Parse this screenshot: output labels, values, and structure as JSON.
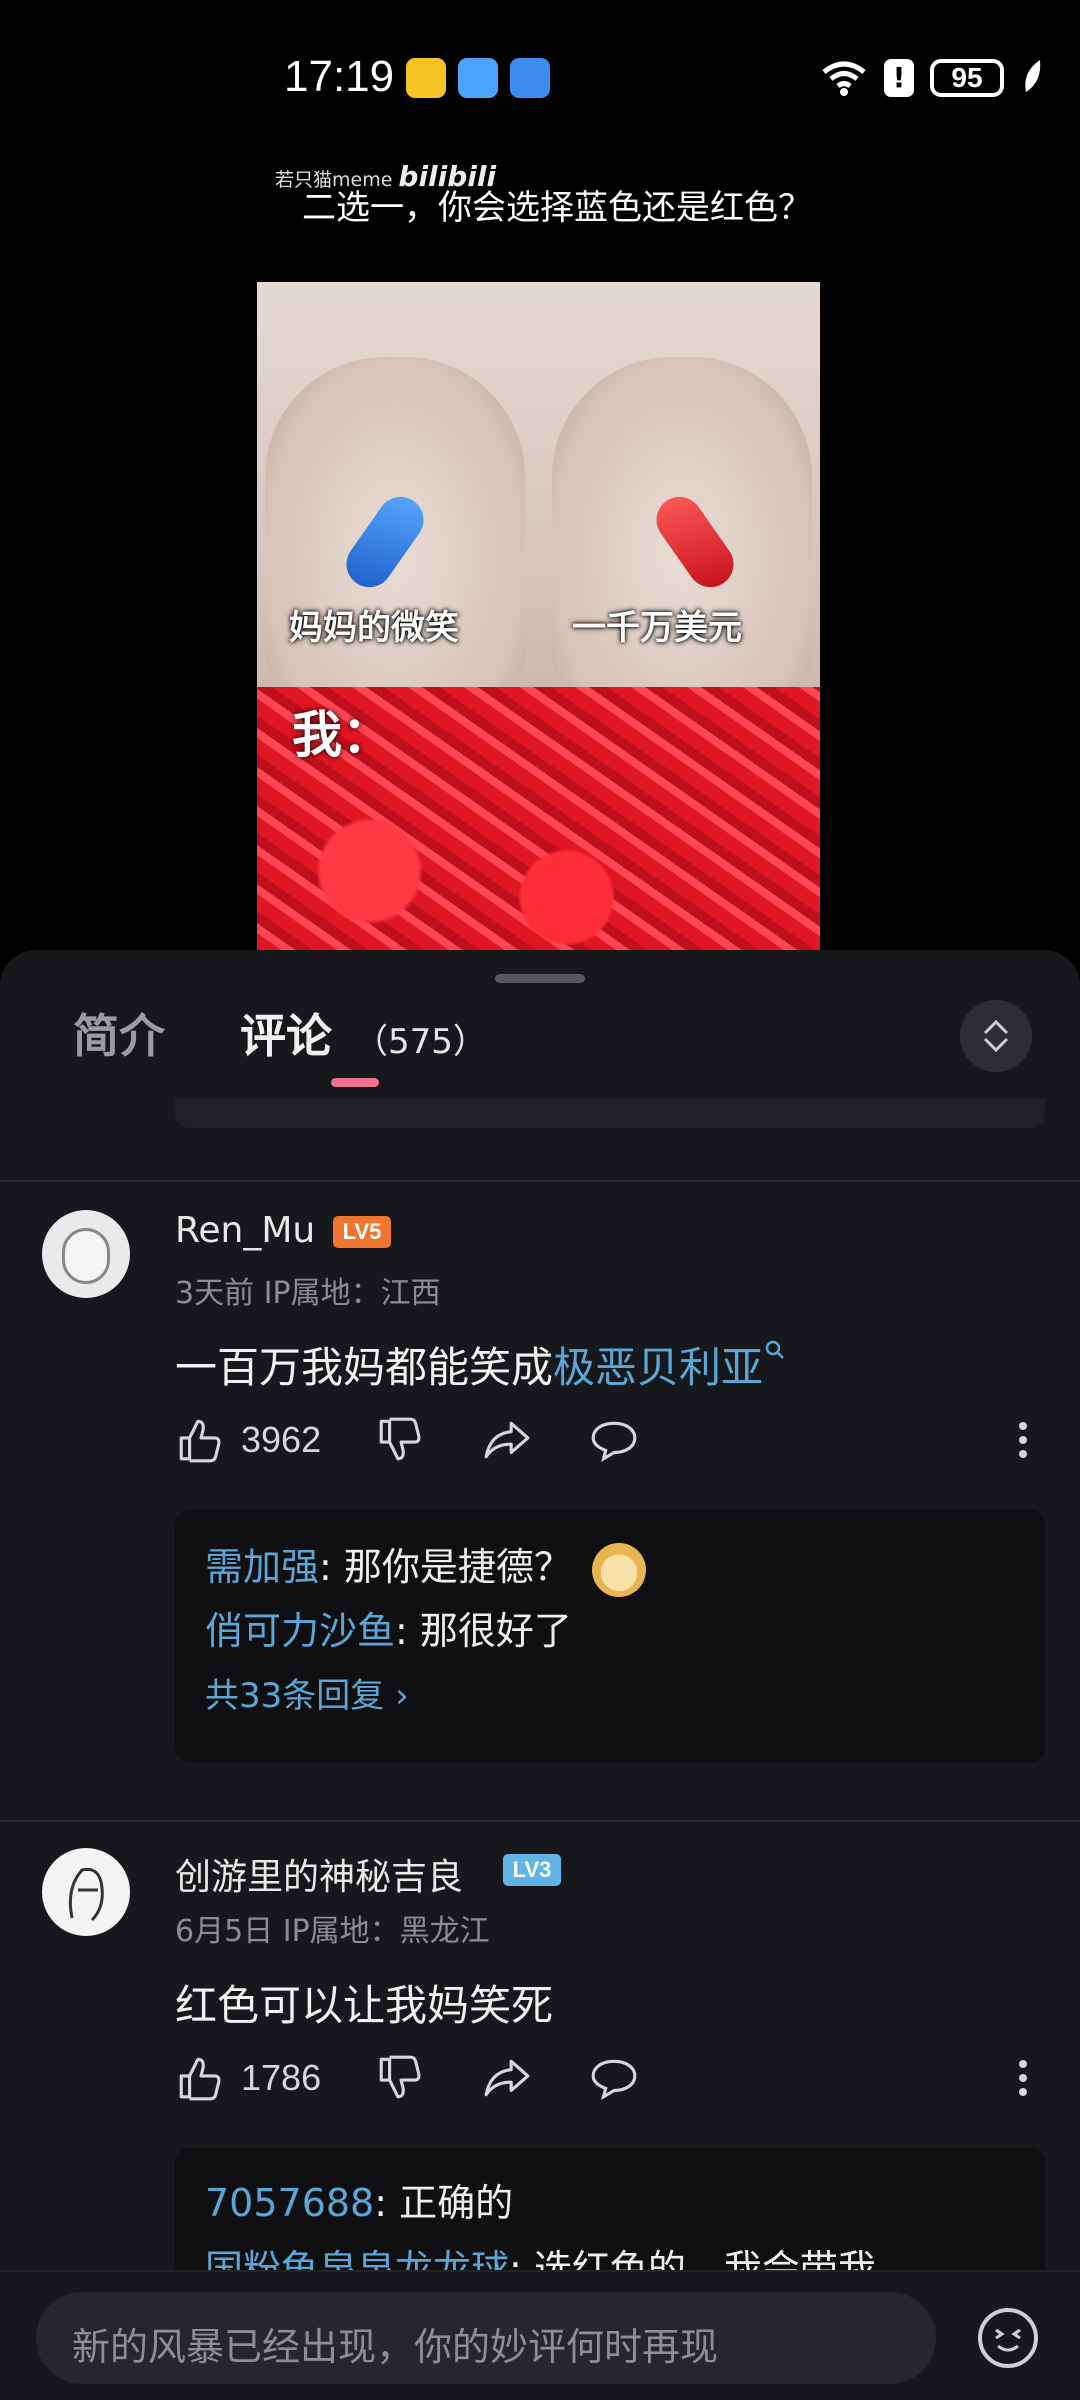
{
  "status_bar": {
    "time": "17:19",
    "battery": "95",
    "alert": "!"
  },
  "video": {
    "watermark_text": "若只猫meme",
    "watermark_logo": "bilibili",
    "caption": "二选一，你会选择蓝色还是红色？",
    "left_label": "妈妈的微笑",
    "right_label": "一千万美元",
    "bottom_label": "我："
  },
  "tabs": {
    "intro": "简介",
    "comments": "评论",
    "count": "（575）"
  },
  "comments": [
    {
      "username": "Ren_Mu",
      "level": "LV5",
      "level_color": "#f0762f",
      "time": "3天前",
      "ip": "IP属地：江西",
      "text_plain": "一百万我妈都能笑成",
      "text_link": "极恶贝利亚",
      "likes": "3962",
      "replies": [
        {
          "user": "需加强",
          "text": ": 那你是捷德？"
        },
        {
          "user": "俏可力沙鱼",
          "text": ": 那很好了"
        }
      ],
      "more_replies": "共33条回复 ›"
    },
    {
      "username": "创游里的神秘吉良",
      "level": "LV3",
      "level_color": "#5fb6e6",
      "time": "6月5日",
      "ip": "IP属地：黑龙江",
      "text_plain": "红色可以让我妈笑死",
      "likes": "1786",
      "replies": [
        {
          "user": "7057688",
          "text": ": 正确的"
        },
        {
          "user": "国粉龟泉泉龙龙球",
          "text": ": 选红色的，我会带我"
        }
      ]
    }
  ],
  "input": {
    "placeholder": "新的风暴已经出现，你的妙评何时再现"
  },
  "colors": {
    "sheet_bg": "#17181c",
    "link": "#5aa6d6",
    "tab_indicator": "#f0728f"
  }
}
